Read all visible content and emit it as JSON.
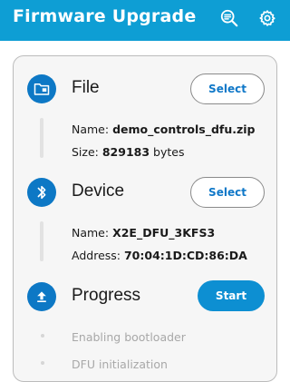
{
  "appbar": {
    "title": "Firmware Upgrade",
    "background": "#0e9ed4",
    "icons": [
      "scan-search-icon",
      "gear-icon"
    ]
  },
  "file": {
    "title": "File",
    "icon": "folder-icon",
    "button_label": "Select",
    "name_label": "Name:",
    "name_value": "demo_controls_dfu.zip",
    "size_label": "Size:",
    "size_value": "829183",
    "size_unit": "bytes"
  },
  "device": {
    "title": "Device",
    "icon": "bluetooth-icon",
    "button_label": "Select",
    "name_label": "Name:",
    "name_value": "X2E_DFU_3KFS3",
    "address_label": "Address:",
    "address_value": "70:04:1D:CD:86:DA"
  },
  "progress": {
    "title": "Progress",
    "icon": "upload-icon",
    "button_label": "Start",
    "steps": [
      "Enabling bootloader",
      "DFU initialization"
    ]
  },
  "colors": {
    "accent": "#0d8fd2",
    "icon_circle": "#0d78c5",
    "muted_text": "#a8a8a8"
  }
}
